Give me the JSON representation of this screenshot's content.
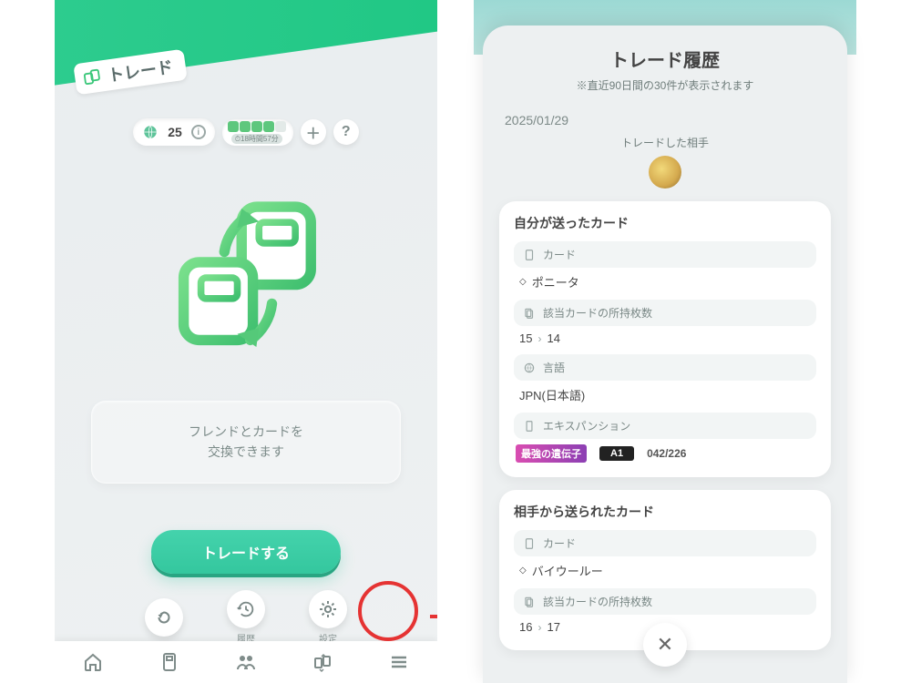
{
  "left": {
    "title": "トレード",
    "token_count": "25",
    "token_timer": "⏱18時間57分",
    "prompt_line1": "フレンドとカードを",
    "prompt_line2": "交換できます",
    "trade_button": "トレードする",
    "history_label": "履歴",
    "settings_label": "設定"
  },
  "right": {
    "heading": "トレード履歴",
    "subtitle": "※直近90日間の30件が表示されます",
    "date": "2025/01/29",
    "partner_label": "トレードした相手",
    "sent": {
      "section_title": "自分が送ったカード",
      "card_label": "カード",
      "card_name": "ポニータ",
      "count_label": "該当カードの所持枚数",
      "count_before": "15",
      "count_after": "14",
      "lang_label": "言語",
      "lang_value": "JPN(日本語)",
      "exp_label": "エキスパンション",
      "exp_badge1": "最強の遺伝子",
      "exp_badge2": "A1",
      "exp_number": "042/226"
    },
    "recv": {
      "section_title": "相手から送られたカード",
      "card_label": "カード",
      "card_name": "バイウールー",
      "count_label": "該当カードの所持枚数",
      "count_before": "16",
      "count_after": "17"
    }
  }
}
